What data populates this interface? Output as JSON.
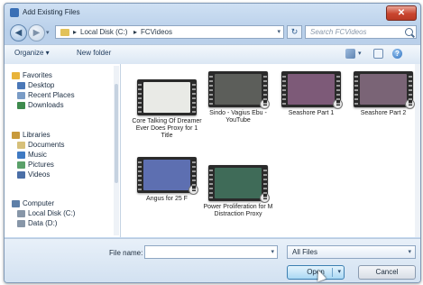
{
  "window": {
    "title": "Add Existing Files"
  },
  "nav": {
    "breadcrumb": [
      "Local Disk (C:)",
      "FCVideos"
    ],
    "search_placeholder": "Search FCVideos"
  },
  "toolbar": {
    "organize": "Organize ▾",
    "new_folder": "New folder"
  },
  "sidebar": {
    "items": [
      {
        "label": "Favorites",
        "icon": "star-icon",
        "color": "#e8b33a"
      },
      {
        "label": "Desktop",
        "icon": "desktop-icon",
        "color": "#4a78b8"
      },
      {
        "label": "Recent Places",
        "icon": "recent-places-icon",
        "color": "#7a9cc6"
      },
      {
        "label": "Downloads",
        "icon": "downloads-icon",
        "color": "#3d8a4d"
      },
      {
        "label": "Libraries",
        "icon": "libraries-icon",
        "color": "#c89a3c"
      },
      {
        "label": "Documents",
        "icon": "documents-icon",
        "color": "#d7c07a"
      },
      {
        "label": "Music",
        "icon": "music-icon",
        "color": "#3f7ac3"
      },
      {
        "label": "Pictures",
        "icon": "pictures-icon",
        "color": "#5aa06a"
      },
      {
        "label": "Videos",
        "icon": "videos-icon",
        "color": "#4b6fa7"
      },
      {
        "label": "Computer",
        "icon": "computer-icon",
        "color": "#5d7fa8"
      },
      {
        "label": "Local Disk (C:)",
        "icon": "drive-icon",
        "color": "#8796a8"
      },
      {
        "label": "Data (D:)",
        "icon": "drive-icon",
        "color": "#8796a8"
      }
    ]
  },
  "files": [
    {
      "label": "Core Talking Of Dreamer Ever Does Proxy for 1 Title",
      "thumb_color": "#e9eae6"
    },
    {
      "label": "Sindo - Vagius Ebu - YouTube",
      "thumb_color": "#5c5e5a"
    },
    {
      "label": "Seashore Part 1",
      "thumb_color": "#7d5a78"
    },
    {
      "label": "Seashore Part 2",
      "thumb_color": "#7a6476"
    },
    {
      "label": "Angus for 25 F",
      "thumb_color": "#5d6fb1"
    },
    {
      "label": "Power Proliferation for M Distraction Proxy",
      "thumb_color": "#3f6b58"
    }
  ],
  "footer": {
    "file_name_label": "File name:",
    "file_name_value": "",
    "filter": "All Files",
    "open_label": "Open",
    "cancel_label": "Cancel"
  }
}
